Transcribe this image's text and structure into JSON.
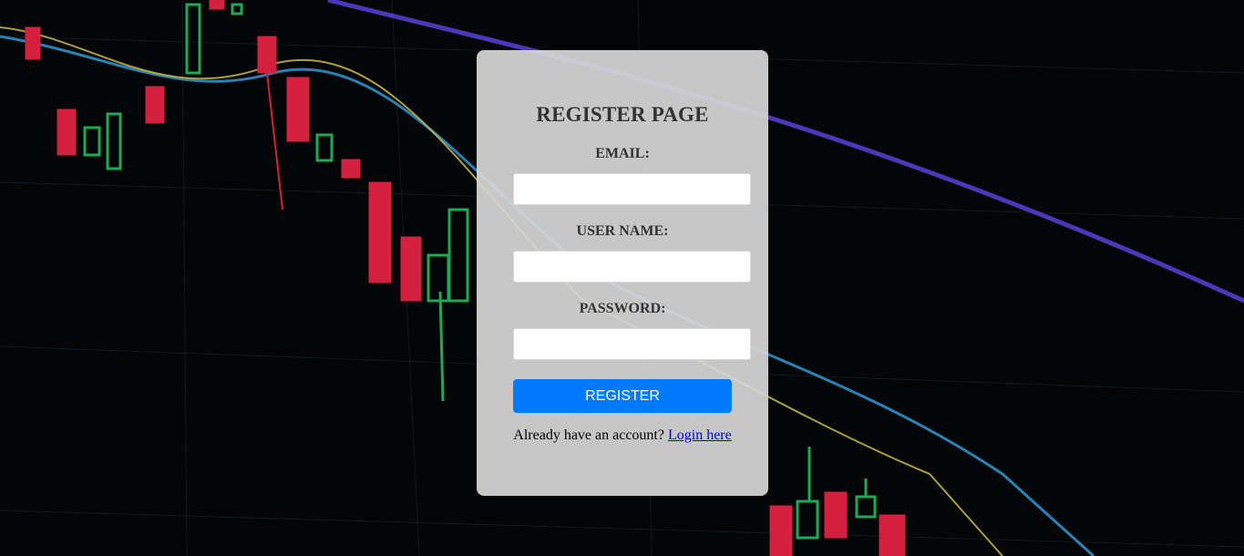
{
  "background": {
    "description_icon": "candlestick-chart-background",
    "colors": {
      "bullish": "#1fa856",
      "bearish": "#d3203f",
      "ma_purple": "#5b3fd6",
      "ma_blue": "#2f8fc6",
      "ma_yellow": "#c9b94a"
    }
  },
  "form": {
    "title": "REGISTER PAGE",
    "email_label": "EMAIL:",
    "email_value": "",
    "username_label": "USER NAME:",
    "username_value": "",
    "password_label": "PASSWORD:",
    "password_value": "",
    "register_button": "REGISTER",
    "login_prompt": "Already have an account?",
    "login_link": "Login here",
    "accent_color": "#007bff"
  }
}
